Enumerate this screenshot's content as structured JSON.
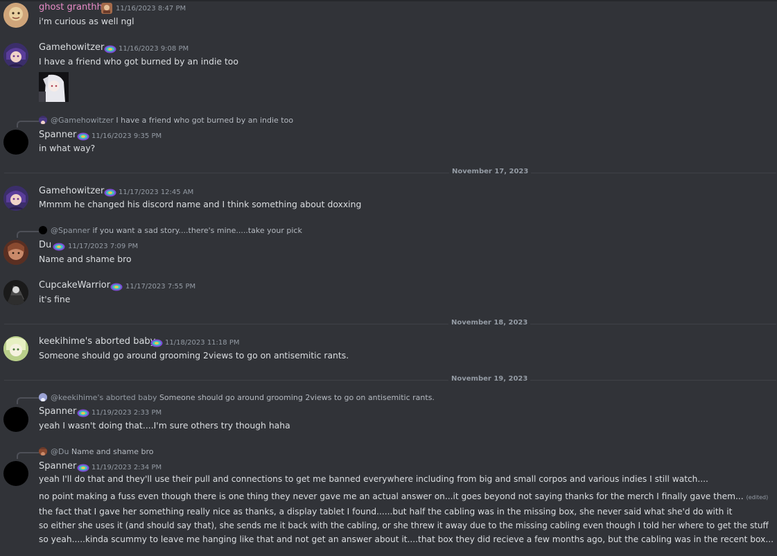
{
  "messages": [
    {
      "username": "ghost granthh",
      "timestamp": "11/16/2023 8:47 PM",
      "lines": [
        "i'm curious as well ngl"
      ]
    },
    {
      "username": "Gamehowitzer",
      "timestamp": "11/16/2023 9:08 PM",
      "lines": [
        "I have a friend who got burned by an indie too"
      ]
    },
    {
      "reply_user": "@Gamehowitzer",
      "reply_text": "I have a friend who got burned by an indie too",
      "username": "Spanner",
      "timestamp": "11/16/2023 9:35 PM",
      "lines": [
        "in what way?"
      ]
    },
    {
      "username": "Gamehowitzer",
      "timestamp": "11/17/2023 12:45 AM",
      "lines": [
        "Mmmm he changed his discord name and I think something about doxxing"
      ]
    },
    {
      "reply_user": "@Spanner",
      "reply_text": "if you want a sad story....there's mine.....take your pick",
      "username": "Du",
      "timestamp": "11/17/2023 7:09 PM",
      "lines": [
        "Name and shame bro"
      ]
    },
    {
      "username": "CupcakeWarrior",
      "timestamp": "11/17/2023 7:55 PM",
      "lines": [
        "it's fine"
      ]
    },
    {
      "username": "keekihime's aborted baby",
      "timestamp": "11/18/2023 11:18 PM",
      "lines": [
        "Someone should go around grooming 2views to go on antisemitic rants."
      ]
    },
    {
      "reply_user": "@keekihime's aborted baby",
      "reply_text": "Someone should go around grooming 2views to go on antisemitic rants.",
      "username": "Spanner",
      "timestamp": "11/19/2023 2:33 PM",
      "lines": [
        "yeah I wasn't doing that....I'm sure others try though haha"
      ]
    },
    {
      "reply_user": "@Du",
      "reply_text": "Name and shame bro",
      "username": "Spanner",
      "timestamp": "11/19/2023 2:34 PM",
      "lines": [
        "yeah I'll do that and they'll use their pull and connections to get me banned everywhere including from big and small corpos and various indies I still watch....",
        "no point making a fuss even though there is one thing they never gave me an actual answer on...it goes beyond not saying thanks for the merch I finally gave them...",
        "the fact that I gave her something really nice as thanks, a display tablet I found......but half the cabling was in the missing box, she never said what she'd do with it",
        "so either she uses it (and should say that), she sends me it back with the cabling, or she threw it away due to the missing cabling even though I told her where to get the stuff",
        "so yeah.....kinda scummy to leave me hanging like that and not get an answer about it....that box they did recieve a few months ago, but the cabling was in the recent box..."
      ],
      "edited_label": "(edited)"
    }
  ],
  "date_separators": [
    "November 17, 2023",
    "November 18, 2023",
    "November 19, 2023"
  ],
  "colors": {
    "ghost_granthh": "#e98cc8",
    "default_name": "#dbdee1",
    "background": "#313338"
  }
}
